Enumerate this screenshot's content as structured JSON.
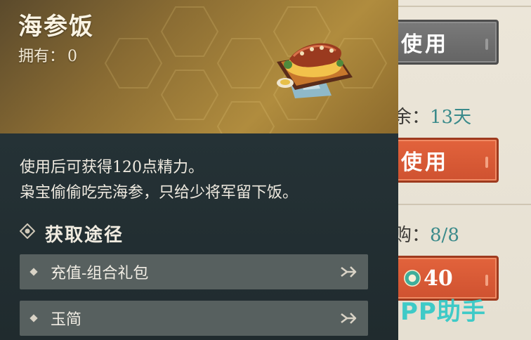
{
  "item": {
    "name": "海参饭",
    "owned_label": "拥有：",
    "owned_value": "0",
    "description_lines": [
      "使用后可获得120点精力。",
      "枭宝偷偷吃完海参，只给少将军留下饭。"
    ],
    "illustration_icon": "seafood-rice-dish-icon"
  },
  "sources": {
    "title": "获取途径",
    "title_icon": "diamond-target-icon",
    "items": [
      {
        "label": "充值-组合礼包",
        "arrow_icon": "go-arrow-icon"
      },
      {
        "label": "玉简",
        "arrow_icon": "go-arrow-icon"
      }
    ]
  },
  "shop_panel": {
    "buttons": [
      {
        "label": "使用",
        "state": "disabled",
        "color": "#6e6e6e"
      },
      {
        "label": "使用",
        "state": "active",
        "color": "#d95a34"
      }
    ],
    "remaining_prefix": "余：",
    "remaining_value": "13天",
    "limit_prefix": "购：",
    "limit_value": "8/8",
    "price": {
      "value": "40",
      "currency_icon": "jade-coin-icon"
    }
  },
  "watermark": "PP助手",
  "colors": {
    "accent_teal": "#3a8a8a",
    "button_red": "#d95a34",
    "card_dark": "#232f32",
    "card_head_gold": "#a98536"
  }
}
